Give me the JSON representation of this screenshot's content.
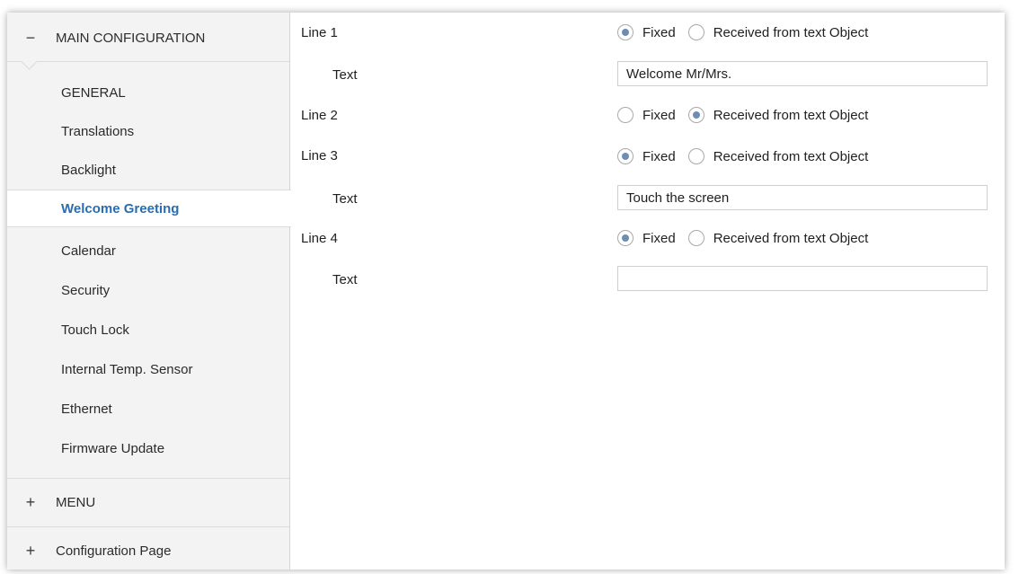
{
  "sidebar": {
    "main_group": {
      "sign": "−",
      "label": "MAIN CONFIGURATION"
    },
    "items": [
      {
        "label": "GENERAL"
      },
      {
        "label": "Translations"
      },
      {
        "label": "Backlight"
      },
      {
        "label": "Welcome Greeting",
        "selected": true
      },
      {
        "label": "Calendar"
      },
      {
        "label": "Security"
      },
      {
        "label": "Touch Lock"
      },
      {
        "label": "Internal Temp. Sensor"
      },
      {
        "label": "Ethernet"
      },
      {
        "label": "Firmware Update"
      }
    ],
    "menu_group": {
      "sign": "+",
      "label": "MENU"
    },
    "config_group": {
      "sign": "+",
      "label": "Configuration Page"
    }
  },
  "main": {
    "option_fixed": "Fixed",
    "option_received": "Received from text Object",
    "text_label": "Text",
    "lines": [
      {
        "label": "Line 1",
        "selected": "fixed",
        "text_value": "Welcome Mr/Mrs."
      },
      {
        "label": "Line 2",
        "selected": "received"
      },
      {
        "label": "Line 3",
        "selected": "fixed",
        "text_value": "Touch the screen"
      },
      {
        "label": "Line 4",
        "selected": "fixed",
        "text_value": ""
      }
    ]
  },
  "colors": {
    "sidebar_bg": "#f3f3f3",
    "selected_text": "#2b6cb0",
    "radio_dot": "#6f8db3"
  }
}
